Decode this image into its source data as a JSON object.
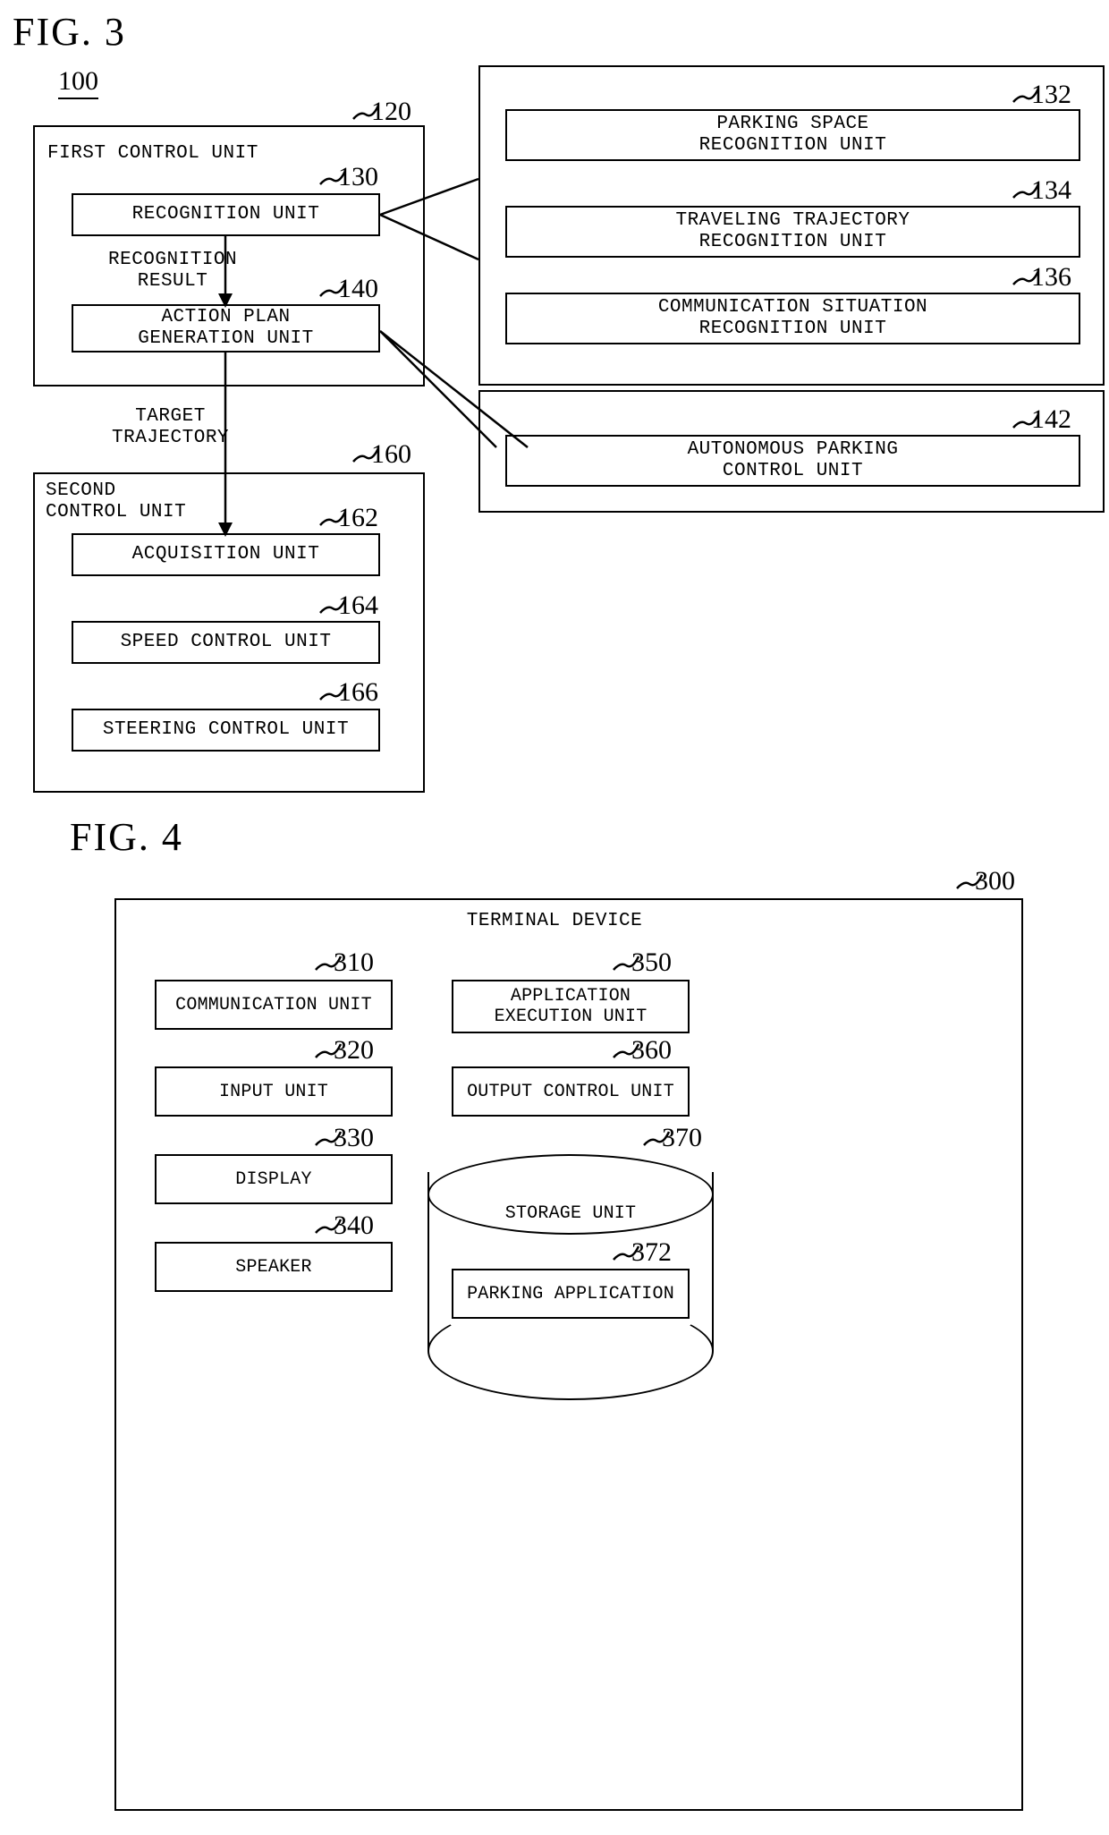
{
  "figures": [
    {
      "title": "FIG. 3",
      "system_ref": "100",
      "blocks": {
        "first_control_unit": {
          "label": "FIRST CONTROL UNIT",
          "ref": "120"
        },
        "recognition_unit": {
          "label": "RECOGNITION UNIT",
          "ref": "130"
        },
        "action_plan_generation_unit": {
          "label": "ACTION PLAN\nGENERATION UNIT",
          "ref": "140"
        },
        "second_control_unit": {
          "label": "SECOND\nCONTROL UNIT",
          "ref": "160"
        },
        "acquisition_unit": {
          "label": "ACQUISITION UNIT",
          "ref": "162"
        },
        "speed_control_unit": {
          "label": "SPEED CONTROL UNIT",
          "ref": "164"
        },
        "steering_control_unit": {
          "label": "STEERING CONTROL UNIT",
          "ref": "166"
        },
        "parking_space_recognition_unit": {
          "label": "PARKING SPACE\nRECOGNITION UNIT",
          "ref": "132"
        },
        "traveling_trajectory_recognition_unit": {
          "label": "TRAVELING TRAJECTORY\nRECOGNITION UNIT",
          "ref": "134"
        },
        "communication_situation_recognition_unit": {
          "label": "COMMUNICATION SITUATION\nRECOGNITION UNIT",
          "ref": "136"
        },
        "autonomous_parking_control_unit": {
          "label": "AUTONOMOUS PARKING\nCONTROL UNIT",
          "ref": "142"
        }
      },
      "flow_labels": {
        "recognition_result": "RECOGNITION\nRESULT",
        "target_trajectory": "TARGET\nTRAJECTORY"
      }
    },
    {
      "title": "FIG. 4",
      "blocks": {
        "terminal_device": {
          "label": "TERMINAL DEVICE",
          "ref": "300"
        },
        "communication_unit": {
          "label": "COMMUNICATION UNIT",
          "ref": "310"
        },
        "input_unit": {
          "label": "INPUT UNIT",
          "ref": "320"
        },
        "display": {
          "label": "DISPLAY",
          "ref": "330"
        },
        "speaker": {
          "label": "SPEAKER",
          "ref": "340"
        },
        "application_execution_unit": {
          "label": "APPLICATION\nEXECUTION UNIT",
          "ref": "350"
        },
        "output_control_unit": {
          "label": "OUTPUT CONTROL UNIT",
          "ref": "360"
        },
        "storage_unit": {
          "label": "STORAGE UNIT",
          "ref": "370"
        },
        "parking_application": {
          "label": "PARKING APPLICATION",
          "ref": "372"
        }
      }
    }
  ]
}
